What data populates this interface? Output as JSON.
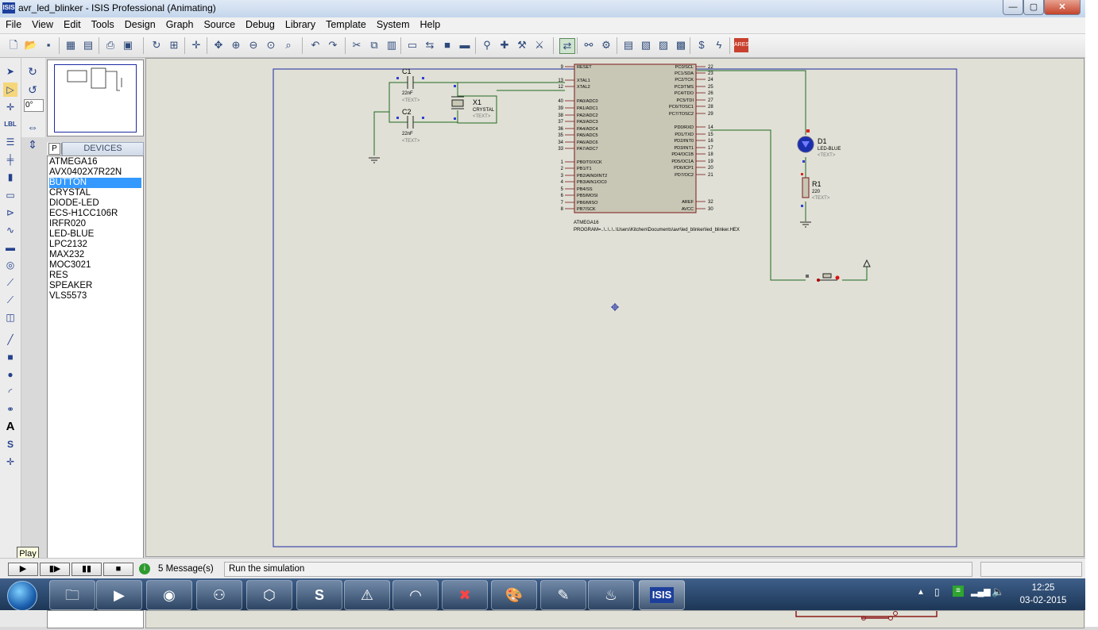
{
  "window": {
    "title": "avr_led_blinker - ISIS Professional (Animating)",
    "app_icon": "ISIS",
    "minimize": "—",
    "maximize": "▢",
    "close": "✕"
  },
  "menu": [
    "File",
    "View",
    "Edit",
    "Tools",
    "Design",
    "Graph",
    "Source",
    "Debug",
    "Library",
    "Template",
    "System",
    "Help"
  ],
  "rotation": {
    "angle": "0°"
  },
  "devices": {
    "title": "DEVICES",
    "p_label": "P",
    "l_label": "L",
    "items": [
      "ATMEGA16",
      "AVX0402X7R22N",
      "BUTTON",
      "CRYSTAL",
      "DIODE-LED",
      "ECS-H1CC106R",
      "IRFR020",
      "LED-BLUE",
      "LPC2132",
      "MAX232",
      "MOC3021",
      "RES",
      "SPEAKER",
      "VLS5573"
    ],
    "selected": "BUTTON"
  },
  "schematic": {
    "c1": {
      "ref": "C1",
      "value": "22nF",
      "text": "<TEXT>"
    },
    "c2": {
      "ref": "C2",
      "value": "22nF",
      "text": "<TEXT>"
    },
    "x1": {
      "ref": "X1",
      "value": "CRYSTAL",
      "text": "<TEXT>"
    },
    "d1": {
      "ref": "D1",
      "value": "LED-BLUE",
      "text": "<TEXT>"
    },
    "r1": {
      "ref": "R1",
      "value": "220",
      "text": "<TEXT>"
    },
    "mcu": {
      "name": "ATMEGA16",
      "program": "PROGRAM=..\\..\\..\\..\\Users\\Kitchen\\Documents\\avr\\led_blinker\\led_blinker.HEX",
      "left_pins": [
        {
          "num": "9",
          "name": "RESET"
        },
        {
          "num": "13",
          "name": "XTAL1"
        },
        {
          "num": "12",
          "name": "XTAL2"
        },
        {
          "num": "40",
          "name": "PA0/ADC0"
        },
        {
          "num": "39",
          "name": "PA1/ADC1"
        },
        {
          "num": "38",
          "name": "PA2/ADC2"
        },
        {
          "num": "37",
          "name": "PA3/ADC3"
        },
        {
          "num": "36",
          "name": "PA4/ADC4"
        },
        {
          "num": "35",
          "name": "PA5/ADC5"
        },
        {
          "num": "34",
          "name": "PA6/ADC6"
        },
        {
          "num": "33",
          "name": "PA7/ADC7"
        },
        {
          "num": "1",
          "name": "PB0/T0/XCK"
        },
        {
          "num": "2",
          "name": "PB1/T1"
        },
        {
          "num": "3",
          "name": "PB2/AIN0/INT2"
        },
        {
          "num": "4",
          "name": "PB3/AIN1/OC0"
        },
        {
          "num": "5",
          "name": "PB4/SS"
        },
        {
          "num": "6",
          "name": "PB5/MOSI"
        },
        {
          "num": "7",
          "name": "PB6/MISO"
        },
        {
          "num": "8",
          "name": "PB7/SCK"
        }
      ],
      "right_pins": [
        {
          "num": "22",
          "name": "PC0/SCL"
        },
        {
          "num": "23",
          "name": "PC1/SDA"
        },
        {
          "num": "24",
          "name": "PC2/TCK"
        },
        {
          "num": "25",
          "name": "PC3/TMS"
        },
        {
          "num": "26",
          "name": "PC4/TDO"
        },
        {
          "num": "27",
          "name": "PC5/TDI"
        },
        {
          "num": "28",
          "name": "PC6/TOSC1"
        },
        {
          "num": "29",
          "name": "PC7/TOSC2"
        },
        {
          "num": "14",
          "name": "PD0/RXD"
        },
        {
          "num": "15",
          "name": "PD1/TXD"
        },
        {
          "num": "16",
          "name": "PD2/INT0"
        },
        {
          "num": "17",
          "name": "PD3/INT1"
        },
        {
          "num": "18",
          "name": "PD4/OC1B"
        },
        {
          "num": "19",
          "name": "PD5/OC1A"
        },
        {
          "num": "20",
          "name": "PD6/ICP1"
        },
        {
          "num": "21",
          "name": "PD7/OC2"
        },
        {
          "num": "32",
          "name": "AREF"
        },
        {
          "num": "30",
          "name": "AVCC"
        }
      ]
    }
  },
  "status": {
    "tooltip": "Play",
    "controls": [
      "▶",
      "▮▶",
      "▮▮",
      "■"
    ],
    "messages": "5 Message(s)",
    "status_text": "Run the simulation"
  },
  "taskbar": {
    "apps": [
      "explorer",
      "media-player",
      "chrome",
      "python",
      "cube",
      "s-app",
      "avr-studio",
      "arc-app",
      "xilinx",
      "paint",
      "notepad",
      "genie",
      "isis"
    ],
    "isis_label": "ISIS",
    "time": "12:25",
    "date": "03-02-2015"
  }
}
